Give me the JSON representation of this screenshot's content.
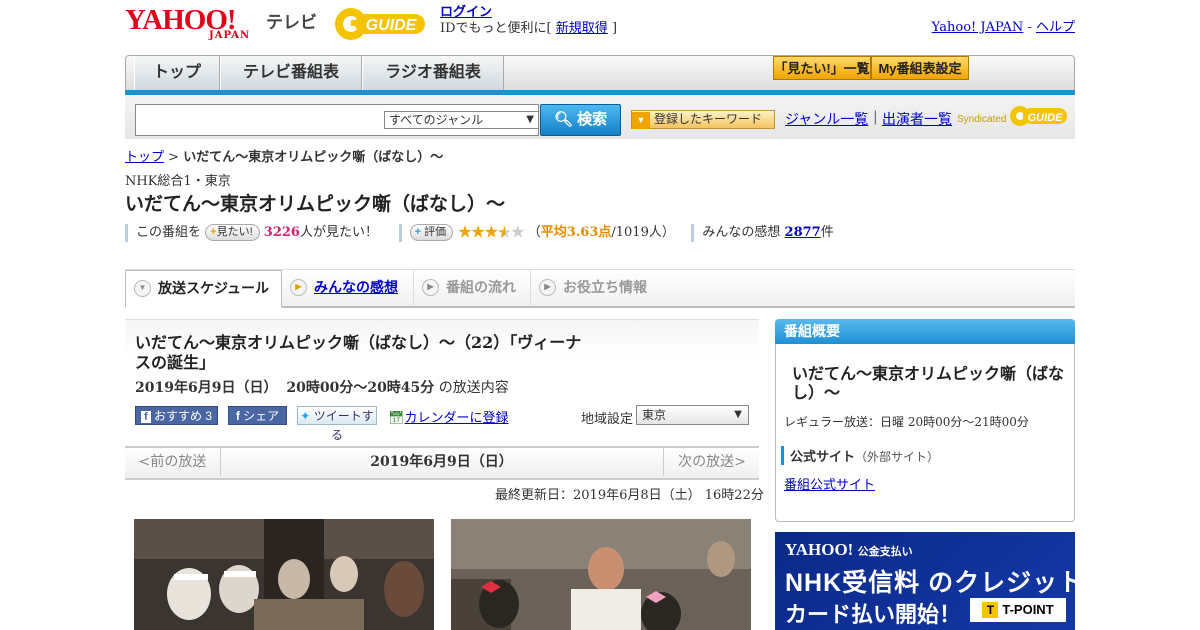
{
  "header": {
    "logo_main": "YAHOO!",
    "logo_sub": "JAPAN",
    "tv_label": "テレビ",
    "gguide_text": "GUIDE",
    "login_label": "ログイン",
    "login_sub_prefix": "IDでもっと便利に[",
    "register_label": "新規取得",
    "login_sub_suffix": "]",
    "yahoo_japan_link": "Yahoo! JAPAN",
    "dash": "-",
    "help_link": "ヘルプ"
  },
  "nav": {
    "tabs": [
      "トップ",
      "テレビ番組表",
      "ラジオ番組表"
    ],
    "mitai_list": "「見たい!」一覧",
    "my_schedule": "My番組表設定"
  },
  "search": {
    "genre_value": "すべてのジャンル",
    "button_label": "検索",
    "keyword_button": "登録したキーワード",
    "genre_list_link": "ジャンル一覧",
    "separator": "|",
    "performer_link": "出演者一覧",
    "syndicated": "Syndicated",
    "syndicated_guide": "GUIDE"
  },
  "breadcrumb": {
    "top": "トップ",
    "sep": ">",
    "current": "いだてん～東京オリムピック噺（ばなし）～"
  },
  "program": {
    "channel": "NHK総合1・東京",
    "title": "いだてん～東京オリムピック噺（ばなし）～",
    "want_prefix": "この番組を",
    "want_button": "見たい!",
    "want_count": "3226",
    "want_suffix": "人が見たい！",
    "rate_button": "評価",
    "avg_prefix": "（",
    "avg_label": "平均3.63点",
    "avg_suffix": "/1019人）",
    "rating_value": 3.63,
    "rating_max": 5,
    "impressions_label": "みんなの感想",
    "impressions_count": "2877",
    "impressions_suffix": "件"
  },
  "tabs": [
    {
      "label": "放送スケジュール"
    },
    {
      "label": "みんなの感想"
    },
    {
      "label": "番組の流れ"
    },
    {
      "label": "お役立ち情報"
    }
  ],
  "episode": {
    "title": "いだてん～東京オリムピック噺（ばなし）～（22）「ヴィーナスの誕生」",
    "date": "2019年6月9日（日）",
    "time": "20時00分～20時45分",
    "date_suffix": "の放送内容",
    "fb_recommend": "おすすめ",
    "fb_count": "3",
    "fb_share": "シェア",
    "tweet": "ツイートする",
    "calendar": "カレンダーに登録",
    "region_label": "地域設定",
    "region_value": "東京"
  },
  "datenav": {
    "prev": "<前の放送",
    "current": "2019年6月9日（日）",
    "next": "次の放送>"
  },
  "updated": "最終更新日：2019年6月8日（土） 16時22分",
  "summary": {
    "heading": "番組概要",
    "title": "いだてん～東京オリムピック噺（ばなし）～",
    "regular": "レギュラー放送：日曜 20時00分～21時00分",
    "official_heading": "公式サイト",
    "official_note": "（外部サイト）",
    "official_link": "番組公式サイト"
  },
  "ad": {
    "logo": "YAHOO!",
    "logo_sub": "公金支払い",
    "line1": "NHK受信料 のクレジット",
    "line2": "カード払い開始！",
    "tpoint": "T-POINT"
  }
}
